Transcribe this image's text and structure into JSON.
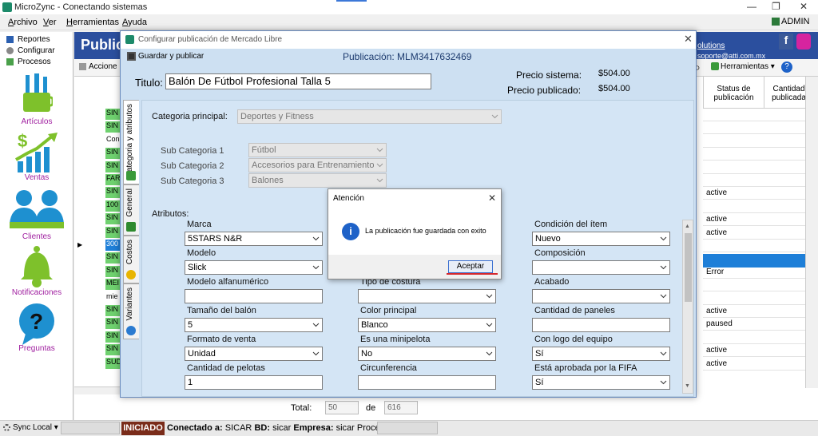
{
  "window": {
    "title": "MicroZync - Conectando sistemas",
    "user": "ADMIN"
  },
  "menu": [
    "Archivo",
    "Ver",
    "Herramientas",
    "Ayuda"
  ],
  "sidebar": {
    "nav": [
      "Reportes",
      "Configurar",
      "Procesos"
    ],
    "items": [
      {
        "label": "Artículos",
        "icon": "articles-brush-icon"
      },
      {
        "label": "Ventas",
        "icon": "sales-chart-icon"
      },
      {
        "label": "Clientes",
        "icon": "clients-icon"
      },
      {
        "label": "Notificaciones",
        "icon": "bell-icon"
      },
      {
        "label": "Preguntas",
        "icon": "question-icon"
      }
    ]
  },
  "background": {
    "header_title": "Public",
    "acciones": "Accione",
    "solutions_text": "olutions",
    "email_text": "soporte@atti.com.mx",
    "herramientas": "Herramientas",
    "col_status": "Status de publicación",
    "col_cantidad": "Cantidad publicada",
    "rows": [
      {
        "code": "SIN",
        "status": ""
      },
      {
        "code": "SIN",
        "status": ""
      },
      {
        "code": "Con",
        "status": ""
      },
      {
        "code": "SIN",
        "status": ""
      },
      {
        "code": "SIN",
        "status": ""
      },
      {
        "code": "FAR",
        "status": ""
      },
      {
        "code": "SIN",
        "status": "active"
      },
      {
        "code": "100",
        "status": ""
      },
      {
        "code": "SIN",
        "status": "active"
      },
      {
        "code": "SIN",
        "status": "active"
      },
      {
        "code": "300",
        "status": ""
      },
      {
        "code": "SIN",
        "status": ""
      },
      {
        "code": "SIN",
        "status": "Error"
      },
      {
        "code": "MEI",
        "status": ""
      },
      {
        "code": "mie",
        "status": ""
      },
      {
        "code": "SIN",
        "status": "active"
      },
      {
        "code": "SIN",
        "status": "paused"
      },
      {
        "code": "SIN",
        "status": ""
      },
      {
        "code": "SIN",
        "status": "active"
      },
      {
        "code": "SUD",
        "status": "active"
      }
    ],
    "total_label": "Total:",
    "total_value": "50",
    "de_label": "de",
    "de_value": "616"
  },
  "dialog": {
    "title": "Configurar publicación de Mercado Libre",
    "save_label": "Guardar y publicar",
    "publicacion": "Publicación: MLM3417632469",
    "titulo_label": "Titulo:",
    "titulo_value": "Balón De Fútbol Profesional Talla 5",
    "precio_sistema_label": "Precio sistema:",
    "precio_sistema_value": "$504.00",
    "precio_publicado_label": "Precio publicado:",
    "precio_publicado_value": "$504.00",
    "tabs": [
      "Categoria y atributos",
      "General",
      "Costos",
      "Variantes"
    ],
    "categoria_label": "Categoria principal:",
    "categoria_value": "Deportes y Fitness",
    "sub1_label": "Sub Categoria 1",
    "sub1_value": "Fútbol",
    "sub2_label": "Sub Categoria 2",
    "sub2_value": "Accesorios para Entrenamiento",
    "sub3_label": "Sub Categoria 3",
    "sub3_value": "Balones",
    "atributos_label": "Atributos:",
    "attrs": {
      "marca": {
        "label": "Marca",
        "value": "5STARS N&R"
      },
      "modelo": {
        "label": "Modelo",
        "value": "Slick"
      },
      "alfanumerico": {
        "label": "Modelo alfanumérico",
        "value": ""
      },
      "tamano": {
        "label": "Tamaño del balón",
        "value": "5"
      },
      "formato": {
        "label": "Formato de venta",
        "value": "Unidad"
      },
      "cantidad_pelotas": {
        "label": "Cantidad de pelotas",
        "value": "1"
      },
      "tipo_costura": {
        "label": "Tipo de costura",
        "value": ""
      },
      "color": {
        "label": "Color principal",
        "value": "Blanco"
      },
      "minipelota": {
        "label": "Es una minipelota",
        "value": "No"
      },
      "circunferencia": {
        "label": "Circunferencia",
        "value": ""
      },
      "condicion": {
        "label": "Condición del ítem",
        "value": "Nuevo"
      },
      "composicion": {
        "label": "Composición",
        "value": ""
      },
      "acabado": {
        "label": "Acabado",
        "value": ""
      },
      "paneles": {
        "label": "Cantidad de paneles",
        "value": ""
      },
      "logo": {
        "label": "Con logo del equipo",
        "value": "Sí"
      },
      "fifa": {
        "label": "Está aprobada por la FIFA",
        "value": "Sí"
      }
    }
  },
  "alert": {
    "title": "Atención",
    "message": "La publicación fue guardada con exito",
    "ok_label": "Aceptar"
  },
  "statusbar": {
    "sync": "Sync Local",
    "state": "INICIADO",
    "conectado_label": "Conectado a:",
    "conectado_value": "SICAR",
    "bd_label": "BD:",
    "bd_value": "sicar",
    "empresa_label": "Empresa:",
    "empresa_value": "sicar",
    "procesos": "Procesos"
  },
  "colors": {
    "accent": "#2b4f9e",
    "dialog_bg": "#cde0f2",
    "grid_green": "#6fd16f",
    "selected_row": "#1e7fd8",
    "iniciado": "#7a2c1a"
  }
}
